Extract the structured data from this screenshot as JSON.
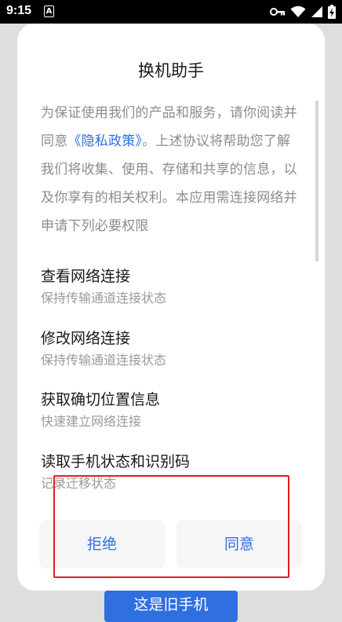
{
  "status_bar": {
    "time": "9:15",
    "notification_glyph": "A",
    "icons": [
      "vpn-key-icon",
      "wifi-icon",
      "signal-icon",
      "battery-charging-icon"
    ]
  },
  "background": {
    "old_phone_button": "这是旧手机"
  },
  "dialog": {
    "title": "换机助手",
    "intro_part1": "为保证使用我们的产品和服务，请你阅读并同意",
    "privacy_link": "《隐私政策》",
    "intro_part2": "。上述协议将帮助您了解我们将收集、使用、存储和共享的信息，以及你享有的相关权利。本应用需连接网络并申请下列必要权限",
    "permissions": [
      {
        "title": "查看网络连接",
        "desc": "保持传输通道连接状态"
      },
      {
        "title": "修改网络连接",
        "desc": "保持传输通道连接状态"
      },
      {
        "title": "获取确切位置信息",
        "desc": "快速建立网络连接"
      },
      {
        "title": "读取手机状态和识别码",
        "desc": "记录迁移状态"
      }
    ],
    "reject_label": "拒绝",
    "agree_label": "同意"
  },
  "colors": {
    "accent": "#2f6fe0",
    "highlight": "#e21d1d"
  }
}
